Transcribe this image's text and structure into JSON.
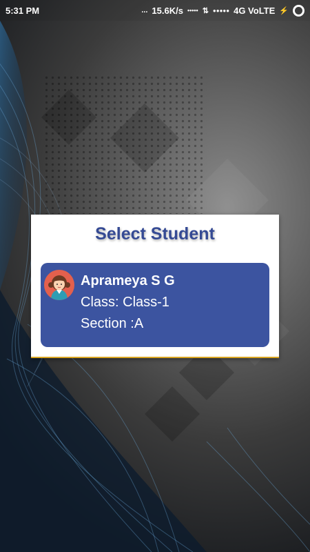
{
  "status_bar": {
    "time": "5:31 PM",
    "network_speed": "15.6K/s",
    "dots": "...",
    "signal_left": "•••••",
    "signal_right": "●●●●●",
    "network_type": "4G VoLTE",
    "icons": [
      "download-arrows-icon",
      "signal-icon",
      "charging-icon",
      "battery-ring-icon"
    ]
  },
  "dialog": {
    "title": "Select Student",
    "students": [
      {
        "name": "Aprameya S G",
        "class_line": "Class: Class-1",
        "section_line": "Section :A",
        "avatar": "student-avatar-icon"
      }
    ]
  },
  "colors": {
    "title": "#354a94",
    "card": "#3c54a0",
    "avatar_bg": "#e3604d",
    "dialog_border": "#d9a520"
  }
}
